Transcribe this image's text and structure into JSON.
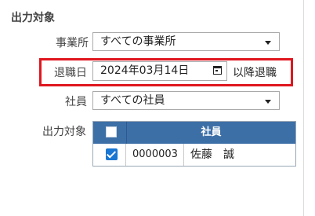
{
  "section_title": "出力対象",
  "office": {
    "label": "事業所",
    "value": "すべての事業所"
  },
  "retirement": {
    "label": "退職日",
    "date": "2024年03月14日",
    "suffix": "以降退職"
  },
  "employee": {
    "label": "社員",
    "value": "すべての社員"
  },
  "output_target": {
    "label": "出力対象",
    "column_header": "社員",
    "rows": [
      {
        "code": "0000003",
        "name": "佐藤　誠",
        "checked": true
      }
    ]
  },
  "colors": {
    "header_bg": "#3d6fa7",
    "highlight": "#e0161e",
    "checkbox": "#1976d2"
  }
}
